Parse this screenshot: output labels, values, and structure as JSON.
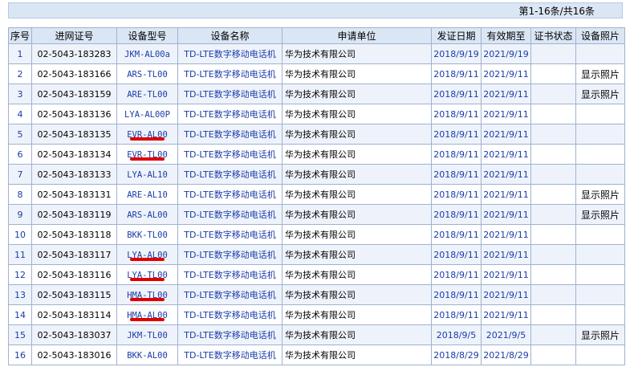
{
  "pager": {
    "text": "第1-16条/共16条"
  },
  "table": {
    "headers": [
      "序号",
      "进网证号",
      "设备型号",
      "设备名称",
      "申请单位",
      "发证日期",
      "有效期至",
      "证书状态",
      "设备照片"
    ],
    "rows": [
      {
        "no": "1",
        "cert": "02-5043-183283",
        "model": "JKM-AL00a",
        "name": "TD-LTE数字移动电话机",
        "org": "华为技术有限公司",
        "issue": "2018/9/19",
        "expire": "2021/9/19",
        "status": "",
        "photo": "",
        "highlight": false
      },
      {
        "no": "2",
        "cert": "02-5043-183166",
        "model": "ARS-TL00",
        "name": "TD-LTE数字移动电话机",
        "org": "华为技术有限公司",
        "issue": "2018/9/11",
        "expire": "2021/9/11",
        "status": "",
        "photo": "显示照片",
        "highlight": false
      },
      {
        "no": "3",
        "cert": "02-5043-183159",
        "model": "ARE-TL00",
        "name": "TD-LTE数字移动电话机",
        "org": "华为技术有限公司",
        "issue": "2018/9/11",
        "expire": "2021/9/11",
        "status": "",
        "photo": "显示照片",
        "highlight": false
      },
      {
        "no": "4",
        "cert": "02-5043-183136",
        "model": "LYA-AL00P",
        "name": "TD-LTE数字移动电话机",
        "org": "华为技术有限公司",
        "issue": "2018/9/11",
        "expire": "2021/9/11",
        "status": "",
        "photo": "",
        "highlight": false
      },
      {
        "no": "5",
        "cert": "02-5043-183135",
        "model": "EVR-AL00",
        "name": "TD-LTE数字移动电话机",
        "org": "华为技术有限公司",
        "issue": "2018/9/11",
        "expire": "2021/9/11",
        "status": "",
        "photo": "",
        "highlight": true
      },
      {
        "no": "6",
        "cert": "02-5043-183134",
        "model": "EVR-TL00",
        "name": "TD-LTE数字移动电话机",
        "org": "华为技术有限公司",
        "issue": "2018/9/11",
        "expire": "2021/9/11",
        "status": "",
        "photo": "",
        "highlight": true
      },
      {
        "no": "7",
        "cert": "02-5043-183133",
        "model": "LYA-AL10",
        "name": "TD-LTE数字移动电话机",
        "org": "华为技术有限公司",
        "issue": "2018/9/11",
        "expire": "2021/9/11",
        "status": "",
        "photo": "",
        "highlight": false
      },
      {
        "no": "8",
        "cert": "02-5043-183131",
        "model": "ARE-AL10",
        "name": "TD-LTE数字移动电话机",
        "org": "华为技术有限公司",
        "issue": "2018/9/11",
        "expire": "2021/9/11",
        "status": "",
        "photo": "显示照片",
        "highlight": false
      },
      {
        "no": "9",
        "cert": "02-5043-183119",
        "model": "ARS-AL00",
        "name": "TD-LTE数字移动电话机",
        "org": "华为技术有限公司",
        "issue": "2018/9/11",
        "expire": "2021/9/11",
        "status": "",
        "photo": "显示照片",
        "highlight": false
      },
      {
        "no": "10",
        "cert": "02-5043-183118",
        "model": "BKK-TL00",
        "name": "TD-LTE数字移动电话机",
        "org": "华为技术有限公司",
        "issue": "2018/9/11",
        "expire": "2021/9/11",
        "status": "",
        "photo": "",
        "highlight": false
      },
      {
        "no": "11",
        "cert": "02-5043-183117",
        "model": "LYA-AL00",
        "name": "TD-LTE数字移动电话机",
        "org": "华为技术有限公司",
        "issue": "2018/9/11",
        "expire": "2021/9/11",
        "status": "",
        "photo": "",
        "highlight": true
      },
      {
        "no": "12",
        "cert": "02-5043-183116",
        "model": "LYA-TL00",
        "name": "TD-LTE数字移动电话机",
        "org": "华为技术有限公司",
        "issue": "2018/9/11",
        "expire": "2021/9/11",
        "status": "",
        "photo": "",
        "highlight": true
      },
      {
        "no": "13",
        "cert": "02-5043-183115",
        "model": "HMA-TL00",
        "name": "TD-LTE数字移动电话机",
        "org": "华为技术有限公司",
        "issue": "2018/9/11",
        "expire": "2021/9/11",
        "status": "",
        "photo": "",
        "highlight": true
      },
      {
        "no": "14",
        "cert": "02-5043-183114",
        "model": "HMA-AL00",
        "name": "TD-LTE数字移动电话机",
        "org": "华为技术有限公司",
        "issue": "2018/9/11",
        "expire": "2021/9/11",
        "status": "",
        "photo": "",
        "highlight": true
      },
      {
        "no": "15",
        "cert": "02-5043-183037",
        "model": "JKM-TL00",
        "name": "TD-LTE数字移动电话机",
        "org": "华为技术有限公司",
        "issue": "2018/9/5",
        "expire": "2021/9/5",
        "status": "",
        "photo": "显示照片",
        "highlight": false
      },
      {
        "no": "16",
        "cert": "02-5043-183016",
        "model": "BKK-AL00",
        "name": "TD-LTE数字移动电话机",
        "org": "华为技术有限公司",
        "issue": "2018/8/29",
        "expire": "2021/8/29",
        "status": "",
        "photo": "",
        "highlight": false
      }
    ]
  },
  "colors": {
    "header_bg": "#dbe6f5",
    "link": "#1a3ca8",
    "highlight_underline": "#e00000",
    "border": "#9fb2cf"
  }
}
